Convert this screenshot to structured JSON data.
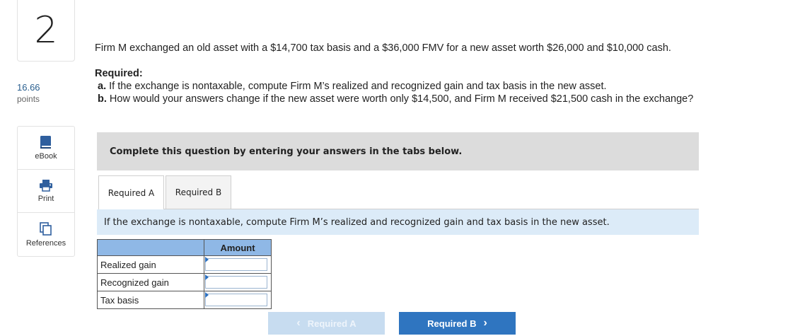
{
  "question": {
    "number": "2",
    "points_value": "16.66",
    "points_label": "points"
  },
  "tools": [
    {
      "label": "eBook",
      "icon": "book-icon"
    },
    {
      "label": "Print",
      "icon": "printer-icon"
    },
    {
      "label": "References",
      "icon": "references-icon"
    }
  ],
  "problem": {
    "text": "Firm M exchanged an old asset with a $14,700 tax basis and a $36,000 FMV for a new asset worth $26,000 and $10,000 cash.",
    "required_heading": "Required:",
    "req_a_prefix": "a.",
    "req_a_text": "If the exchange is nontaxable, compute Firm M’s realized and recognized gain and tax basis in the new asset.",
    "req_b_prefix": "b.",
    "req_b_text": "How would your answers change if the new asset were worth only $14,500, and Firm M received $21,500 cash in the exchange?"
  },
  "instructions": "Complete this question by entering your answers in the tabs below.",
  "tabs": [
    {
      "label": "Required A",
      "active": true
    },
    {
      "label": "Required B",
      "active": false
    }
  ],
  "tab_prompt": "If the exchange is nontaxable, compute Firm M’s realized and recognized gain and tax basis in the new asset.",
  "answer_table": {
    "column_header": "Amount",
    "rows": [
      {
        "label": "Realized gain",
        "value": ""
      },
      {
        "label": "Recognized gain",
        "value": ""
      },
      {
        "label": "Tax basis",
        "value": ""
      }
    ]
  },
  "nav": {
    "prev_label": "Required A",
    "next_label": "Required B"
  },
  "colors": {
    "accent": "#2f75c0",
    "accent_disabled": "#c7dcf0",
    "header_fill": "#8fb8e6",
    "prompt_band": "#dcebf8"
  }
}
